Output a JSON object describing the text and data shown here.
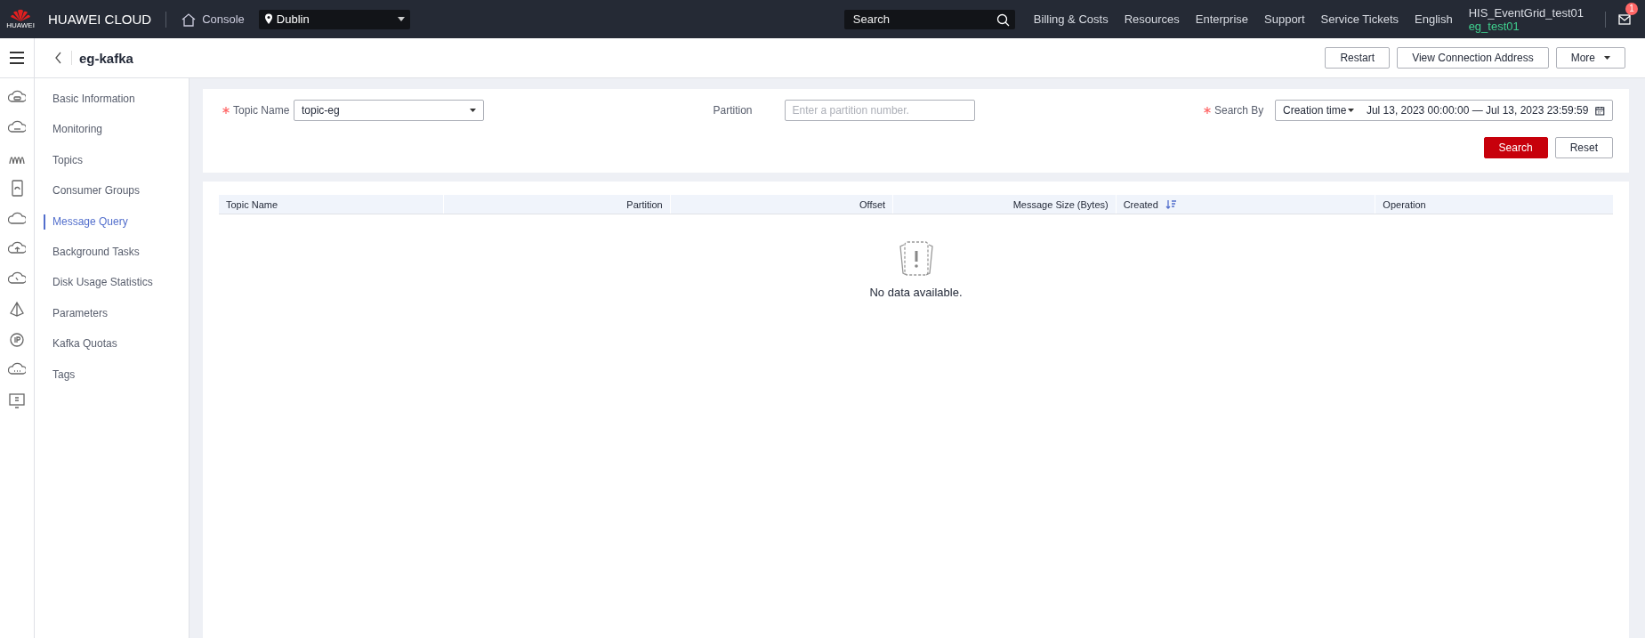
{
  "topbar": {
    "logo_text": "HUAWEI",
    "brand": "HUAWEI CLOUD",
    "console": "Console",
    "region": "Dublin",
    "search": {
      "placeholder": "Search"
    },
    "links": [
      "Billing & Costs",
      "Resources",
      "Enterprise",
      "Support",
      "Service Tickets",
      "English"
    ],
    "account": {
      "name": "HIS_EventGrid_test01",
      "user": "eg_test01"
    },
    "notifications": "1"
  },
  "header": {
    "title": "eg-kafka",
    "buttons": [
      {
        "label": "Restart",
        "kind": "plain"
      },
      {
        "label": "View Connection Address",
        "kind": "plain"
      },
      {
        "label": "More",
        "kind": "dropdown"
      }
    ]
  },
  "sidebar": {
    "items": [
      {
        "label": "Basic Information",
        "selected": false
      },
      {
        "label": "Monitoring",
        "selected": false
      },
      {
        "label": "Topics",
        "selected": false
      },
      {
        "label": "Consumer Groups",
        "selected": false
      },
      {
        "label": "Message Query",
        "selected": true
      },
      {
        "label": "Background Tasks",
        "selected": false
      },
      {
        "label": "Disk Usage Statistics",
        "selected": false
      },
      {
        "label": "Parameters",
        "selected": false
      },
      {
        "label": "Kafka Quotas",
        "selected": false
      },
      {
        "label": "Tags",
        "selected": false
      }
    ]
  },
  "filter": {
    "topic_name": {
      "label": "Topic Name",
      "required": true,
      "value": "topic-eg"
    },
    "partition": {
      "label": "Partition",
      "required": false,
      "placeholder": "Enter a partition number."
    },
    "search_by": {
      "label": "Search By",
      "required": true,
      "mode": "Creation time",
      "range": "Jul 13, 2023 00:00:00 — Jul 13, 2023 23:59:59"
    },
    "buttons": [
      {
        "label": "Search",
        "kind": "primary"
      },
      {
        "label": "Reset",
        "kind": "plain"
      }
    ]
  },
  "table": {
    "columns": [
      {
        "label": "Topic Name",
        "sortable": false
      },
      {
        "label": "Partition",
        "sortable": false
      },
      {
        "label": "Offset",
        "sortable": false
      },
      {
        "label": "Message Size (Bytes)",
        "sortable": false
      },
      {
        "label": "Created",
        "sortable": true
      },
      {
        "label": "Operation",
        "sortable": false
      }
    ],
    "empty_text": "No data available."
  }
}
